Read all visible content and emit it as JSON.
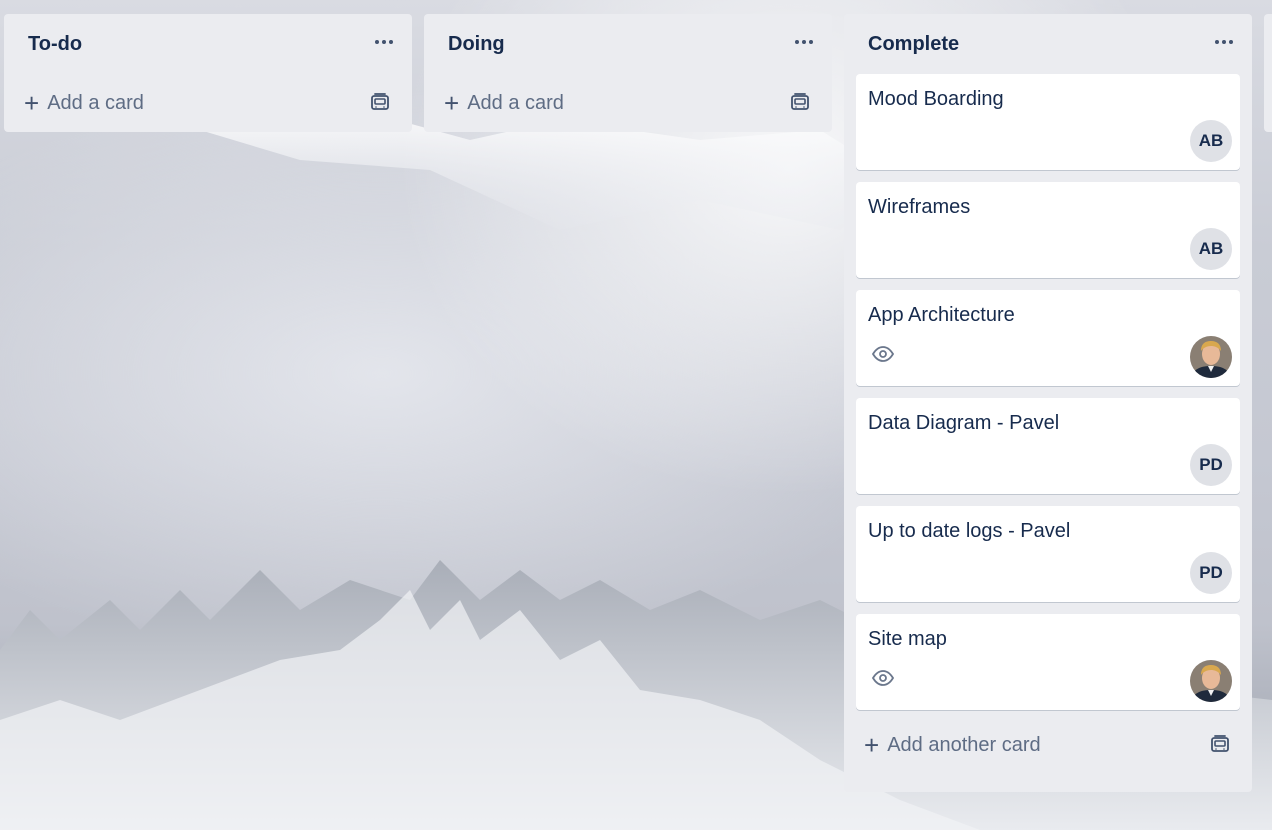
{
  "lists": [
    {
      "title": "To-do",
      "add_label": "Add a card",
      "cards": []
    },
    {
      "title": "Doing",
      "add_label": "Add a card",
      "cards": []
    },
    {
      "title": "Complete",
      "add_label": "Add another card",
      "cards": [
        {
          "title": "Mood Boarding",
          "member": "AB",
          "watched": false
        },
        {
          "title": "Wireframes",
          "member": "AB",
          "watched": false
        },
        {
          "title": "App Architecture",
          "member": "photo",
          "watched": true
        },
        {
          "title": "Data Diagram - Pavel",
          "member": "PD",
          "watched": false
        },
        {
          "title": "Up to date logs - Pavel",
          "member": "PD",
          "watched": false
        },
        {
          "title": "Site map",
          "member": "photo",
          "watched": true
        }
      ]
    }
  ],
  "icons": {
    "list_menu": "ellipsis-icon",
    "add": "plus-icon",
    "template": "card-template-icon",
    "watch": "eye-icon"
  },
  "colors": {
    "list_bg": "#ebecf0",
    "text": "#172b4d",
    "muted": "#5e6c84"
  }
}
